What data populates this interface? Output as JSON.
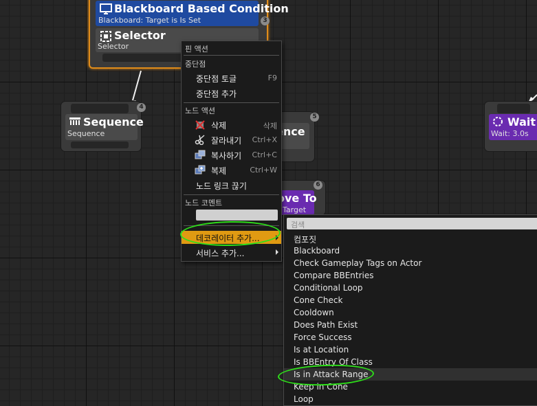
{
  "colors": {
    "orange_selection": "#e08c1a",
    "blackboard_header": "#1f4aa0",
    "purple_task": "#6a2bb0",
    "menu_highlight": "#e09a12",
    "annotation_green": "#2ee01a"
  },
  "nodes": {
    "blackboard": {
      "title": "Blackboard Based Condition",
      "subtitle": "Blackboard: Target is Is Set",
      "badge": "3",
      "icon": "monitor-icon"
    },
    "selector": {
      "title": "Selector",
      "subtitle": "Selector",
      "icon": "selector-icon"
    },
    "sequence": {
      "title": "Sequence",
      "subtitle": "Sequence",
      "badge": "4",
      "icon": "sequence-icon"
    },
    "sequence2": {
      "title_fragment": "ence",
      "badge": "5"
    },
    "moveto": {
      "title_fragment": "ove To",
      "subtitle_fragment": "Target",
      "badge": "6"
    },
    "wait": {
      "title": "Wait",
      "subtitle": "Wait: 3.0s",
      "icon": "wait-icon"
    }
  },
  "context_menu": {
    "pin_actions": "핀 액션",
    "breakpoint_header": "중단점",
    "toggle_breakpoint": "중단점 토글",
    "toggle_breakpoint_shortcut": "F9",
    "add_breakpoint": "중단점 추가",
    "node_actions_header": "노드 액션",
    "delete": "삭제",
    "delete_shortcut": "삭제",
    "cut": "잘라내기",
    "cut_shortcut": "Ctrl+X",
    "copy": "복사하기",
    "copy_shortcut": "Ctrl+C",
    "duplicate": "복제",
    "duplicate_shortcut": "Ctrl+W",
    "break_links": "노드 링크 끊기",
    "node_comment_header": "노드 코멘트",
    "add_decorator": "데코레이터 추가...",
    "add_service": "서비스 추가..."
  },
  "submenu": {
    "search_placeholder": "검색",
    "items": [
      "컴포짓",
      "Blackboard",
      "Check Gameplay Tags on Actor",
      "Compare BBEntries",
      "Conditional Loop",
      "Cone Check",
      "Cooldown",
      "Does Path Exist",
      "Force Success",
      "Is at Location",
      "Is BBEntry Of Class",
      "Is in Attack Range",
      "Keep in Cone",
      "Loop"
    ],
    "hovered_item": "Is in Attack Range"
  }
}
